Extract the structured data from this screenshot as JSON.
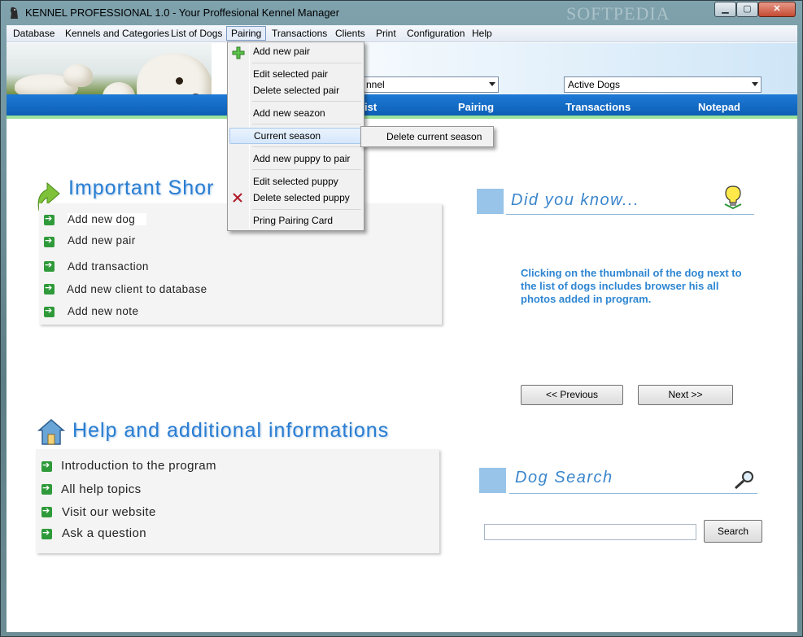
{
  "window": {
    "title": "KENNEL PROFESSIONAL 1.0 - Your Proffesional Kennel Manager",
    "watermark": "SOFTPEDIA",
    "controls": {
      "minimize": "▁",
      "maximize": "▢",
      "close": "✕"
    }
  },
  "menubar": {
    "items": [
      "Database",
      "Kennels and Categories",
      "List of Dogs",
      "Pairing",
      "Transactions",
      "Clients",
      "Print",
      "Configuration",
      "Help"
    ],
    "open_menu": "Pairing"
  },
  "header": {
    "kennel_select": "nnel",
    "filter_select": "Active Dogs"
  },
  "nav": {
    "items": [
      "ist",
      "Pairing",
      "Transactions",
      "Notepad"
    ]
  },
  "pairing_menu": {
    "items": [
      {
        "label": "Add new pair",
        "icon": "plus-icon"
      },
      {
        "label": "Edit selected pair"
      },
      {
        "label": "Delete selected pair"
      },
      {
        "label": "Add new seazon"
      },
      {
        "label": "Current season",
        "highlighted": true,
        "has_submenu": true
      },
      {
        "label": "Add new puppy to pair"
      },
      {
        "label": "Edit selected puppy"
      },
      {
        "label": "Delete selected puppy",
        "icon": "delete-x-icon"
      },
      {
        "label": "Pring Pairing Card"
      }
    ],
    "submenu": {
      "items": [
        "Delete current season"
      ]
    }
  },
  "shortcuts": {
    "title": "Important Shor",
    "links": [
      "Add new dog",
      "Add new pair",
      "Add transaction",
      "Add new client to database",
      "Add new note"
    ]
  },
  "help": {
    "title": "Help and additional informations",
    "links": [
      "Introduction to the program",
      "All help topics",
      "Visit our website",
      "Ask a question"
    ]
  },
  "did_you_know": {
    "title": "Did you know...",
    "tip": "Clicking on the thumbnail of the dog next to the list of dogs includes browser his all photos added in program.",
    "prev_label": "<< Previous",
    "next_label": "Next >>"
  },
  "dog_search": {
    "title": "Dog Search",
    "input_value": "",
    "button_label": "Search"
  },
  "colors": {
    "nav_blue": "#0d5fb6",
    "title_blue": "#2a7ed2",
    "tip_blue": "#2e86d2",
    "accent_green": "#9ae39b",
    "link_arrow_green": "#2f9a3a"
  }
}
